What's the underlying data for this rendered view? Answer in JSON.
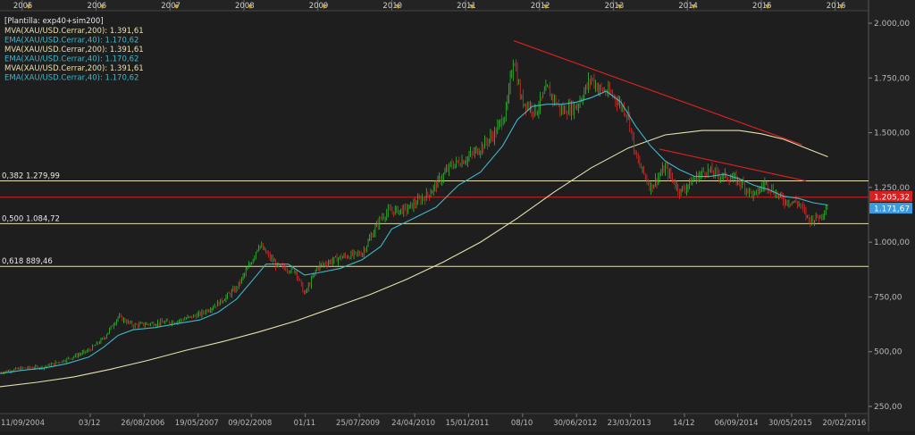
{
  "template_label": "[Plantilla: exp40+sim200]",
  "legend": [
    {
      "text": "MVA(XAU/USD.Cerrar,200): 1.391,61",
      "color": "#e6e0b0"
    },
    {
      "text": "EMA(XAU/USD.Cerrar,40): 1.170,62",
      "color": "#3fb8c8"
    },
    {
      "text": "MVA(XAU/USD.Cerrar,200): 1.391,61",
      "color": "#e6e0b0"
    },
    {
      "text": "EMA(XAU/USD.Cerrar,40): 1.170,62",
      "color": "#3fb8c8"
    },
    {
      "text": "MVA(XAU/USD.Cerrar,200): 1.391,61",
      "color": "#e6e0b0"
    },
    {
      "text": "EMA(XAU/USD.Cerrar,40): 1.170,62",
      "color": "#3fb8c8"
    }
  ],
  "price_badges": [
    {
      "text": "1.205,32",
      "value": 1205.32,
      "bg": "#d92020"
    },
    {
      "text": "1.171,67",
      "value": 1171.67,
      "bg": "#3a9be0"
    }
  ],
  "chart_data": {
    "type": "candlestick",
    "symbol": "XAU/USD",
    "ylim": [
      250,
      2000
    ],
    "xlim": [
      2004.7,
      2016.45
    ],
    "grid": false,
    "y_ticks": [
      {
        "value": 2000,
        "label": "2.000,00"
      },
      {
        "value": 1750,
        "label": "1.750,00"
      },
      {
        "value": 1500,
        "label": "1.500,00"
      },
      {
        "value": 1250,
        "label": "1.250,00"
      },
      {
        "value": 1000,
        "label": "1.000,00"
      },
      {
        "value": 750,
        "label": "750,00"
      },
      {
        "value": 500,
        "label": "500,00"
      },
      {
        "value": 250,
        "label": "250,00"
      }
    ],
    "top_year_ticks": [
      {
        "value": 2005,
        "label": "2005"
      },
      {
        "value": 2006,
        "label": "2006"
      },
      {
        "value": 2007,
        "label": "2007"
      },
      {
        "value": 2008,
        "label": "2008"
      },
      {
        "value": 2009,
        "label": "2009"
      },
      {
        "value": 2010,
        "label": "2010"
      },
      {
        "value": 2011,
        "label": "2011"
      },
      {
        "value": 2012,
        "label": "2012"
      },
      {
        "value": 2013,
        "label": "2013"
      },
      {
        "value": 2014,
        "label": "2014"
      },
      {
        "value": 2015,
        "label": "2015"
      },
      {
        "value": 2016,
        "label": "2016"
      }
    ],
    "bottom_date_ticks": [
      {
        "value": 2004.69,
        "label": "11/09/2004"
      },
      {
        "value": 2005.92,
        "label": "03/12"
      },
      {
        "value": 2006.65,
        "label": "26/08/2006"
      },
      {
        "value": 2007.38,
        "label": "19/05/2007"
      },
      {
        "value": 2008.1,
        "label": "09/02/2008"
      },
      {
        "value": 2008.83,
        "label": "01/11"
      },
      {
        "value": 2009.56,
        "label": "25/07/2009"
      },
      {
        "value": 2010.31,
        "label": "24/04/2010"
      },
      {
        "value": 2011.04,
        "label": "15/01/2011"
      },
      {
        "value": 2011.77,
        "label": "08/10"
      },
      {
        "value": 2012.5,
        "label": "30/06/2012"
      },
      {
        "value": 2013.23,
        "label": "23/03/2013"
      },
      {
        "value": 2013.96,
        "label": "14/12"
      },
      {
        "value": 2014.68,
        "label": "06/09/2014"
      },
      {
        "value": 2015.41,
        "label": "30/05/2015"
      },
      {
        "value": 2016.14,
        "label": "20/02/2016"
      }
    ],
    "fib_levels": [
      {
        "label": "0,382 1.279,99",
        "value": 1279.99
      },
      {
        "label": "0,500 1.084,72",
        "value": 1084.72
      },
      {
        "label": "0,618 889,46",
        "value": 889.46
      }
    ],
    "horizontal_lines": [
      {
        "value": 1205.32,
        "color": "#d92020"
      }
    ],
    "trendlines": [
      {
        "x1": 2011.65,
        "y1": 1920,
        "x2": 2015.55,
        "y2": 1445,
        "color": "#d92020"
      },
      {
        "x1": 2013.62,
        "y1": 1425,
        "x2": 2015.6,
        "y2": 1280,
        "color": "#d92020"
      }
    ],
    "close_series": {
      "name": "XAU/USD",
      "x": [
        2004.7,
        2005.0,
        2005.3,
        2005.6,
        2005.9,
        2006.1,
        2006.3,
        2006.5,
        2006.8,
        2007.1,
        2007.4,
        2007.65,
        2007.9,
        2008.1,
        2008.2,
        2008.45,
        2008.7,
        2008.82,
        2009.0,
        2009.3,
        2009.6,
        2009.85,
        2009.95,
        2010.2,
        2010.5,
        2010.8,
        2011.0,
        2011.2,
        2011.4,
        2011.55,
        2011.65,
        2011.75,
        2011.95,
        2012.1,
        2012.3,
        2012.5,
        2012.7,
        2012.8,
        2013.0,
        2013.2,
        2013.3,
        2013.5,
        2013.7,
        2013.9,
        2014.1,
        2014.25,
        2014.5,
        2014.7,
        2014.9,
        2015.05,
        2015.3,
        2015.5,
        2015.65,
        2015.8,
        2015.9
      ],
      "close": [
        405,
        425,
        430,
        465,
        505,
        560,
        660,
        620,
        630,
        640,
        670,
        720,
        790,
        910,
        990,
        890,
        870,
        760,
        890,
        930,
        950,
        1110,
        1140,
        1150,
        1220,
        1350,
        1380,
        1430,
        1500,
        1600,
        1850,
        1650,
        1600,
        1700,
        1600,
        1620,
        1750,
        1700,
        1670,
        1580,
        1390,
        1250,
        1340,
        1230,
        1290,
        1330,
        1300,
        1280,
        1210,
        1270,
        1190,
        1180,
        1100,
        1120,
        1170
      ]
    },
    "ema40": {
      "name": "EMA(XAU/USD.Cerrar,40)",
      "x": [
        2004.7,
        2005.0,
        2005.3,
        2005.6,
        2005.9,
        2006.1,
        2006.3,
        2006.5,
        2006.8,
        2007.1,
        2007.4,
        2007.65,
        2007.9,
        2008.1,
        2008.3,
        2008.6,
        2008.82,
        2009.0,
        2009.3,
        2009.6,
        2009.85,
        2010.0,
        2010.3,
        2010.6,
        2010.9,
        2011.2,
        2011.5,
        2011.7,
        2011.9,
        2012.1,
        2012.3,
        2012.5,
        2012.7,
        2012.9,
        2013.1,
        2013.3,
        2013.5,
        2013.7,
        2013.9,
        2014.1,
        2014.3,
        2014.5,
        2014.7,
        2014.9,
        2015.1,
        2015.3,
        2015.5,
        2015.7,
        2015.9
      ],
      "y": [
        400,
        415,
        425,
        445,
        475,
        520,
        575,
        600,
        610,
        628,
        645,
        680,
        740,
        820,
        900,
        900,
        850,
        860,
        880,
        920,
        980,
        1060,
        1110,
        1160,
        1260,
        1320,
        1440,
        1560,
        1620,
        1630,
        1630,
        1640,
        1660,
        1690,
        1640,
        1530,
        1440,
        1370,
        1330,
        1300,
        1300,
        1310,
        1290,
        1260,
        1240,
        1210,
        1200,
        1180,
        1170
      ]
    },
    "sma200": {
      "name": "MVA(XAU/USD.Cerrar,200)",
      "x": [
        2004.7,
        2005.2,
        2005.7,
        2006.2,
        2006.7,
        2007.2,
        2007.7,
        2008.2,
        2008.7,
        2009.2,
        2009.7,
        2010.2,
        2010.7,
        2011.2,
        2011.7,
        2012.2,
        2012.7,
        2013.2,
        2013.7,
        2014.2,
        2014.7,
        2015.0,
        2015.3,
        2015.6,
        2015.9
      ],
      "y": [
        340,
        360,
        385,
        420,
        460,
        505,
        545,
        590,
        640,
        700,
        760,
        830,
        910,
        1000,
        1110,
        1230,
        1340,
        1430,
        1490,
        1510,
        1510,
        1495,
        1470,
        1430,
        1390
      ]
    }
  }
}
